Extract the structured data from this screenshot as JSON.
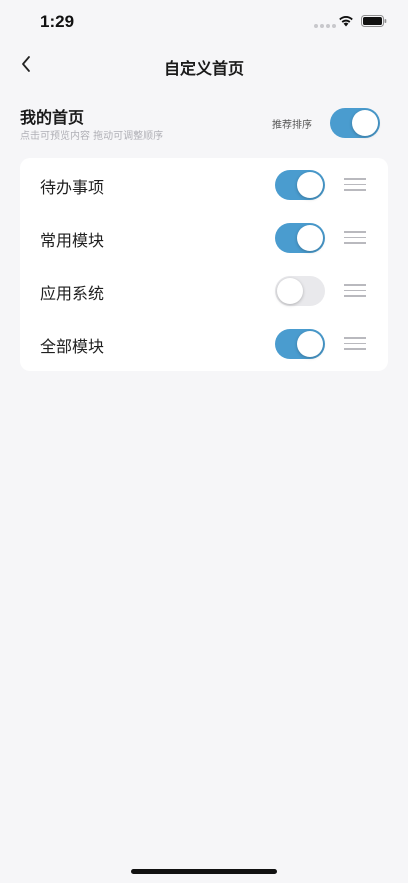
{
  "status_bar": {
    "time": "1:29",
    "icons": [
      "signal-dots-icon",
      "wifi-icon",
      "battery-icon"
    ]
  },
  "nav": {
    "back_icon": "chevron-left-icon",
    "title": "自定义首页"
  },
  "home_section": {
    "title": "我的首页",
    "subtitle": "点击可预览内容 拖动可调整顺序",
    "recommend_label": "推荐排序",
    "recommend_enabled": true
  },
  "modules": [
    {
      "label": "待办事项",
      "enabled": true
    },
    {
      "label": "常用模块",
      "enabled": true
    },
    {
      "label": "应用系统",
      "enabled": false
    },
    {
      "label": "全部模块",
      "enabled": true
    }
  ],
  "colors": {
    "accent": "#4a9ccf",
    "toggle_off": "#e9e9ec",
    "background": "#f6f6f8",
    "card": "#ffffff"
  }
}
